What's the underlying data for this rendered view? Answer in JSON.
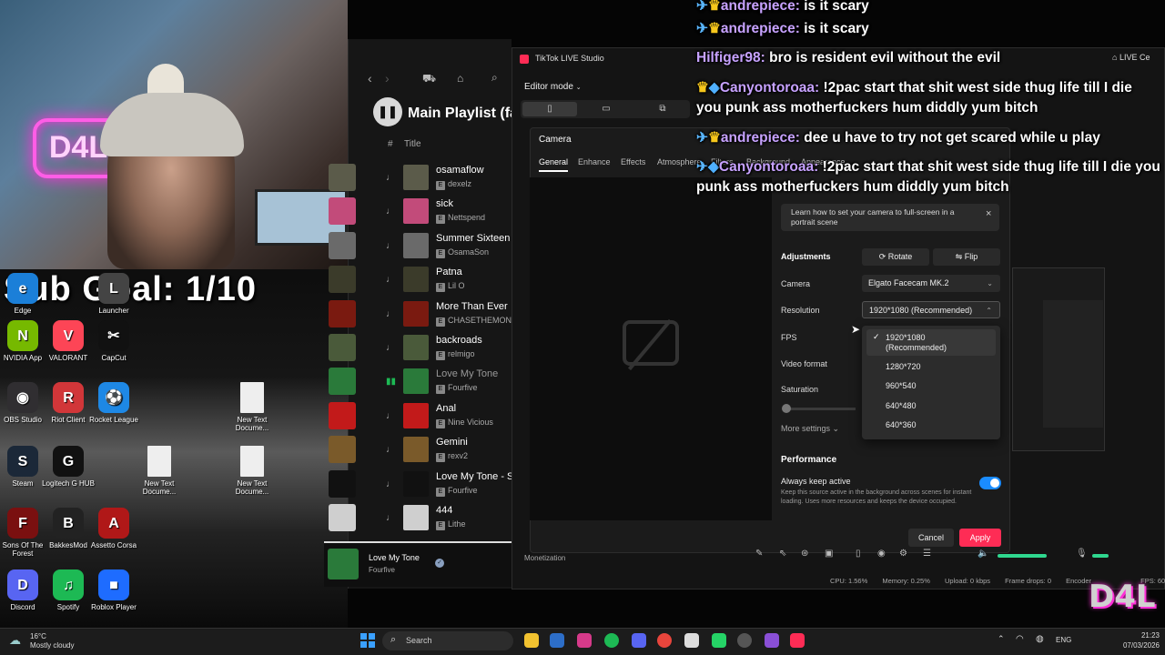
{
  "overlay": {
    "sub_goal": "Sub Goal: 1/10"
  },
  "desktop_icons": [
    {
      "label": "Edge",
      "color": "#1b7fd8",
      "glyph": "e"
    },
    {
      "label": "Launcher",
      "color": "#444",
      "glyph": "L"
    },
    {
      "label": "NVIDIA App",
      "color": "#76b900",
      "glyph": "N"
    },
    {
      "label": "VALORANT",
      "color": "#fd4556",
      "glyph": "V"
    },
    {
      "label": "CapCut",
      "color": "#111",
      "glyph": "✂"
    },
    {
      "label": "OBS Studio",
      "color": "#302e31",
      "glyph": "◉"
    },
    {
      "label": "Riot Client",
      "color": "#d13639",
      "glyph": "R"
    },
    {
      "label": "Rocket League",
      "color": "#1e88e5",
      "glyph": "⚽"
    },
    {
      "label": "New Text Docume...",
      "color": "#eee",
      "glyph": ""
    },
    {
      "label": "Steam",
      "color": "#1b2838",
      "glyph": "S"
    },
    {
      "label": "Logitech G HUB",
      "color": "#111",
      "glyph": "G"
    },
    {
      "label": "New Text Docume...",
      "color": "#eee",
      "glyph": ""
    },
    {
      "label": "New Text Docume...",
      "color": "#eee",
      "glyph": ""
    },
    {
      "label": "Sons Of The Forest",
      "color": "#7a1010",
      "glyph": "F"
    },
    {
      "label": "BakkesMod",
      "color": "#222",
      "glyph": "B"
    },
    {
      "label": "Assetto Corsa",
      "color": "#b01818",
      "glyph": "A"
    },
    {
      "label": "Discord",
      "color": "#5865f2",
      "glyph": "D"
    },
    {
      "label": "Spotify",
      "color": "#1db954",
      "glyph": "♫"
    },
    {
      "label": "Roblox Player",
      "color": "#1e6cff",
      "glyph": "■"
    }
  ],
  "spotify": {
    "playlist_title": "Main Playlist (fa",
    "col_title": "Title",
    "col_hash": "#",
    "tracks": [
      {
        "title": "osamaflow",
        "artist": "dexelz",
        "color": "#5b5b4a"
      },
      {
        "title": "sick",
        "artist": "Nettspend",
        "color": "#c24b7a"
      },
      {
        "title": "Summer Sixteen",
        "artist": "OsamaSon",
        "color": "#6a6a6a"
      },
      {
        "title": "Patna",
        "artist": "Lil O",
        "color": "#3b3b2a"
      },
      {
        "title": "More Than Ever",
        "artist": "CHASETHEMONEY",
        "color": "#7a1a10"
      },
      {
        "title": "backroads",
        "artist": "relmigo",
        "color": "#4a5a3a"
      },
      {
        "title": "Love My Tone",
        "artist": "Fourfive",
        "color": "#2a7a3a"
      },
      {
        "title": "Anal",
        "artist": "Nine Vicious",
        "color": "#c21a1a"
      },
      {
        "title": "Gemini",
        "artist": "rexv2",
        "color": "#7a5a2a"
      },
      {
        "title": "Love My Tone - Sl",
        "artist": "Fourfive",
        "color": "#111"
      },
      {
        "title": "444",
        "artist": "Lithe",
        "color": "#cfcfcf"
      }
    ],
    "now_playing": {
      "title": "Love My Tone",
      "artist": "Fourfive"
    }
  },
  "tiktok": {
    "window_title": "TikTok LIVE Studio",
    "editor_mode": "Editor mode",
    "live_center": "LIVE Ce",
    "dialog": {
      "title": "Camera",
      "tabs": [
        "General",
        "Enhance",
        "Effects",
        "Atmosphere",
        "Filters",
        "Background",
        "Appearance"
      ],
      "hint": "Learn how to set your camera to full-screen in a portrait scene",
      "adjustments_label": "Adjustments",
      "rotate_label": "Rotate",
      "flip_label": "Flip",
      "camera_label": "Camera",
      "camera_value": "Elgato Facecam MK.2",
      "resolution_label": "Resolution",
      "resolution_value": "1920*1080 (Recommended)",
      "fps_label": "FPS",
      "video_format_label": "Video format",
      "saturation_label": "Saturation",
      "more_settings": "More settings",
      "resolution_options": [
        "1920*1080 (Recommended)",
        "1280*720",
        "960*540",
        "640*480",
        "640*360"
      ],
      "performance_title": "Performance",
      "always_active_label": "Always keep active",
      "always_active_desc": "Keep this source active in the background across scenes for instant loading. Uses more resources and keeps the device occupied.",
      "always_active_on": true,
      "cancel": "Cancel",
      "apply": "Apply"
    },
    "monetization": "Monetization",
    "stats": {
      "cpu": "CPU: 1.56%",
      "memory": "Memory: 0.25%",
      "upload": "Upload: 0 kbps",
      "frame_drops": "Frame drops: 0",
      "encoder": "Encoder",
      "fps": "FPS: 60"
    }
  },
  "chat": [
    {
      "user": "andrepiece:",
      "text": "is it scary",
      "badges": "✈👑"
    },
    {
      "user": "Hilfiger98:",
      "text": "bro is resident evil without the evil",
      "badges": ""
    },
    {
      "user": "Canyontoroaa:",
      "text": "!2pac start that shit west side thug life till I die you punk ass motherfuckers hum diddly yum bitch",
      "badges": "👑◆"
    },
    {
      "user": "andrepiece:",
      "text": "dee u have to try not get scared while u play",
      "badges": "✈👑"
    },
    {
      "user": "Canyontoroaa:",
      "text": "!2pac start that shit west side thug life till I die you punk ass motherfuckers hum diddly yum bitch",
      "badges": "✈◆"
    }
  ],
  "taskbar": {
    "weather_temp": "16°C",
    "weather_desc": "Mostly cloudy",
    "search_placeholder": "Search",
    "language": "ENG",
    "time": "21:23",
    "date": "07/03/2026"
  },
  "watermark": "D4L"
}
